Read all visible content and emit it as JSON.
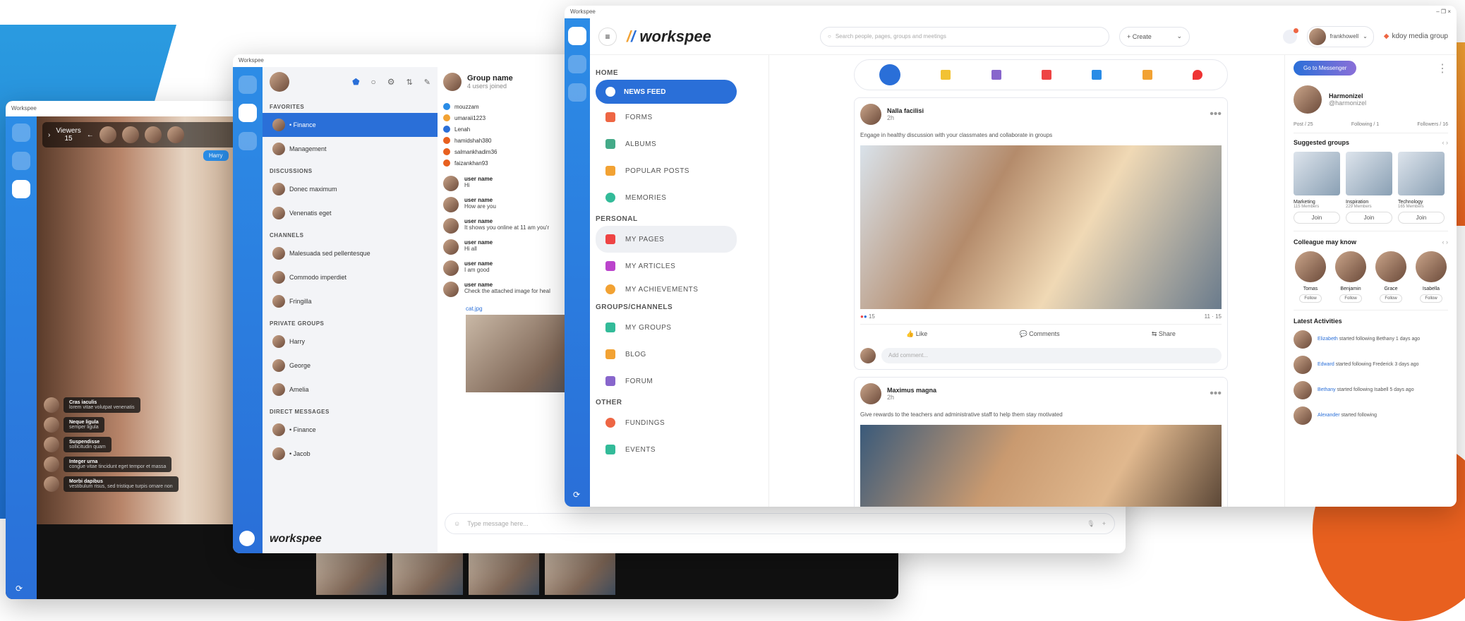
{
  "app": {
    "title": "Workspee",
    "brand": "workspee"
  },
  "video_window": {
    "viewers_label": "Viewers",
    "viewers_count": "15",
    "name_tag": "Harry",
    "comments": [
      {
        "name": "Cras iaculis",
        "text": "lorem vitae volutpat venenatis"
      },
      {
        "name": "Neque ligula",
        "text": "semper ligula"
      },
      {
        "name": "Suspendisse",
        "text": "sollicitudin quam"
      },
      {
        "name": "Integer urna",
        "text": "congue vitae tincidunt eget tempor et massa"
      },
      {
        "name": "Morbi dapibus",
        "text": "vestibulum risus, sed tristique turpis ornare non"
      }
    ]
  },
  "chat_window": {
    "title": "Workspee",
    "sections": {
      "favorites": "FAVORITES",
      "discussions": "DISCUSSIONS",
      "channels": "CHANNELS",
      "private_groups": "PRIVATE GROUPS",
      "direct_messages": "DIRECT MESSAGES"
    },
    "favorites": [
      "• Finance",
      "Management"
    ],
    "discussions": [
      "Donec maximum",
      "Venenatis eget"
    ],
    "channels": [
      "Malesuada sed pellentesque",
      "Commodo imperdiet",
      "Fringilla"
    ],
    "private_groups": [
      "Harry",
      "George",
      "Amelia"
    ],
    "direct_messages": [
      "• Finance",
      "• Jacob"
    ],
    "group_name": "Group name",
    "group_sub": "4 users joined",
    "recent": [
      "mouzzam",
      "umaraii1223",
      "Lenah",
      "hamidshah380",
      "salmankhadim36",
      "faizankhan93"
    ],
    "messages": [
      {
        "user": "user name",
        "text": "Hi"
      },
      {
        "user": "user name",
        "text": "How are you"
      },
      {
        "user": "user name",
        "text": "It shows you online at 11 am you'r"
      },
      {
        "user": "user name",
        "text": "Hi all"
      },
      {
        "user": "user name",
        "text": "I am good"
      },
      {
        "user": "user name",
        "text": "Check the attached image for heal"
      }
    ],
    "attachment": "cat.jpg",
    "input_placeholder": "Type message here...",
    "footer_brand": "workspee"
  },
  "main_window": {
    "title": "Workspee",
    "search_placeholder": "Search people, pages, groups and meetings",
    "create_label": "+ Create",
    "user_name": "frankhowell",
    "company": "kdoy media group",
    "sidebar": {
      "home": "HOME",
      "news_feed": "NEWS FEED",
      "forms": "FORMS",
      "albums": "ALBUMS",
      "popular": "POPULAR POSTS",
      "memories": "MEMORIES",
      "personal": "PERSONAL",
      "my_pages": "MY PAGES",
      "my_articles": "MY ARTICLES",
      "my_achievements": "MY ACHIEVEMENTS",
      "groups": "GROUPS/CHANNELS",
      "my_groups": "MY GROUPS",
      "blog": "BLOG",
      "forum": "FORUM",
      "other": "OTHER",
      "fundings": "FUNDINGS",
      "events": "EVENTS"
    },
    "post1": {
      "author": "Nalla facilisi",
      "time": "2h",
      "text": "Engage in healthy discussion with your classmates and collaborate in groups",
      "reactions": "15",
      "comments_count": "11",
      "shares_count": "15",
      "like": "Like",
      "comment": "Comments",
      "share": "Share",
      "comment_placeholder": "Add comment..."
    },
    "post2": {
      "author": "Maximus magna",
      "time": "2h",
      "text": "Give rewards to the teachers and administrative staff to help them stay motivated"
    },
    "right": {
      "messenger_btn": "Go to Messenger",
      "profile_name": "Harmonizel",
      "profile_handle": "@harmonizel",
      "stats": [
        "Post / 25",
        "Following / 1",
        "Followers / 16"
      ],
      "suggested_title": "Suggested groups",
      "groups": [
        {
          "name": "Marketing",
          "members": "115 Members"
        },
        {
          "name": "Inspiration",
          "members": "229 Members"
        },
        {
          "name": "Technology",
          "members": "165 Members"
        }
      ],
      "join": "Join",
      "colleagues_title": "Colleague may know",
      "colleagues": [
        "Tomas",
        "Benjamin",
        "Grace",
        "Isabella"
      ],
      "follow": "Follow",
      "activities_title": "Latest Activities",
      "activities": [
        {
          "name": "Elizabeth",
          "text": "started following Bethany 1 days ago"
        },
        {
          "name": "Edward",
          "text": "started following Frederick 3 days ago"
        },
        {
          "name": "Bethany",
          "text": "started following Isabell 5 days ago"
        },
        {
          "name": "Alexander",
          "text": "started following"
        }
      ]
    }
  },
  "colors": {
    "primary": "#2a6fd8",
    "accent_orange": "#e8601f",
    "accent_blue": "#1f8ad8"
  }
}
